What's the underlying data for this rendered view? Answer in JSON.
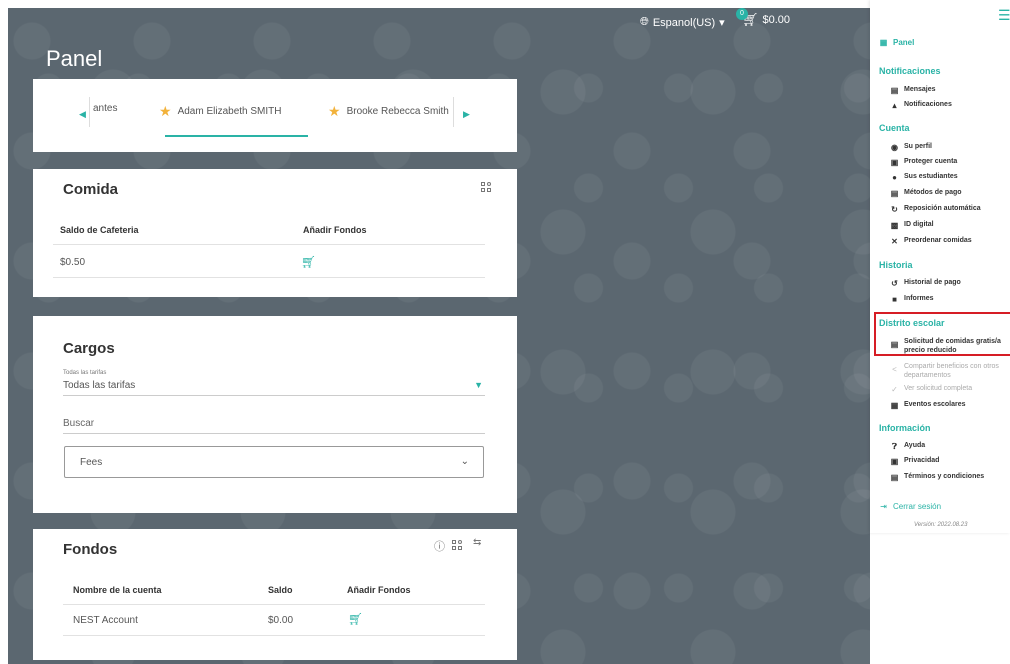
{
  "topbar": {
    "language": "Espanol(US)",
    "cart_count": "0",
    "cart_total": "$0.00"
  },
  "page": {
    "title": "Panel"
  },
  "students": {
    "partial_left": "antes",
    "items": [
      "Adam Elizabeth SMITH",
      "Brooke Rebecca Smith"
    ]
  },
  "comida": {
    "title": "Comida",
    "headers": [
      "Saldo de Cafeteria",
      "Añadir Fondos"
    ],
    "balance": "$0.50"
  },
  "cargos": {
    "title": "Cargos",
    "filter_label": "Todas las tarifas",
    "filter_value": "Todas las tarifas",
    "search_label": "Buscar",
    "select_value": "Fees"
  },
  "fondos": {
    "title": "Fondos",
    "headers": [
      "Nombre de la cuenta",
      "Saldo",
      "Añadir Fondos"
    ],
    "rows": [
      {
        "name": "NEST Account",
        "balance": "$0.00"
      }
    ]
  },
  "sidebar": {
    "panel": "Panel",
    "sections": {
      "notificaciones": "Notificaciones",
      "cuenta": "Cuenta",
      "historia": "Historia",
      "distrito": "Distrito escolar",
      "informacion": "Información"
    },
    "items": {
      "mensajes": "Mensajes",
      "notificaciones": "Notificaciones",
      "perfil": "Su perfil",
      "proteger": "Proteger cuenta",
      "estudiantes": "Sus estudiantes",
      "metodos": "Métodos de pago",
      "reposicion": "Reposición automática",
      "id_digital": "ID digital",
      "preordenar": "Preordenar comidas",
      "historial": "Historial de pago",
      "informes": "Informes",
      "solicitud_1": "Solicitud de comidas gratis/a",
      "solicitud_2": "precio reducido",
      "compartir_1": "Compartir beneficios con otros",
      "compartir_2": "departamentos",
      "ver_solicitud": "Ver solicitud completa",
      "eventos": "Eventos escolares",
      "ayuda": "Ayuda",
      "privacidad": "Privacidad",
      "terminos": "Términos y condiciones"
    },
    "logout": "Cerrar sesión",
    "version": "Versión: 2022.08.23"
  },
  "colors": {
    "accent": "#2ab3a6",
    "background": "#5b6770",
    "highlight": "#d61d25",
    "star": "#f2b23b"
  }
}
